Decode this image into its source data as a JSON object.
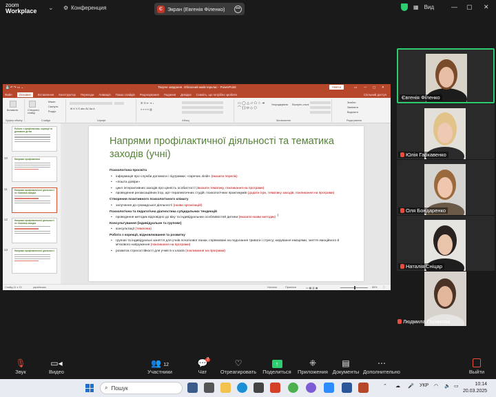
{
  "zoom": {
    "logo_top": "zoom",
    "logo_bottom": "Workplace",
    "conference_label": "Конференция",
    "share_avatar_letter": "Є",
    "share_label": "Экран (Евгенія Філенко)",
    "view_label": "Вид"
  },
  "ppt": {
    "doc_title": "Творче завдання. Обласний майстерклас  -  PowerPoint",
    "signin": "Увійти",
    "tabs": [
      "Файл",
      "Основне",
      "Вставлення",
      "Конструктор",
      "Переходи",
      "Анімація",
      "Показ слайдів",
      "Рецензування",
      "Подання",
      "Довідка",
      "Скажіть, що потрібно зробити"
    ],
    "share_tab": "Спільний доступ",
    "ribbon": {
      "clipboard": "Буфер обміну",
      "slides": "Слайди",
      "font": "Шрифт",
      "paragraph": "Абзац",
      "drawing": "Малювання",
      "editing": "Редагування",
      "insert_btn": "Вставити",
      "new_slide": "Створити слайд",
      "layout": "Макет",
      "reset": "Скинути",
      "section": "Розділ",
      "arrange": "Упорядкувати",
      "quick_styles": "Експрес-стилі",
      "find": "Знайти",
      "replace": "Замінити",
      "select": "Виділити"
    },
    "thumbnails": [
      {
        "num": "",
        "title": "Робота з профілактики, корекції та допомоги дітям"
      },
      {
        "num": "10",
        "title": "Напрями профілактики"
      },
      {
        "num": "11",
        "title": "Напрями профілактичної діяльності та тематика заходів"
      },
      {
        "num": "12",
        "title": "Напрями профілактичної діяльності та тематика заходів"
      },
      {
        "num": "13",
        "title": "Напрями профілактичної діяльності"
      }
    ],
    "slide": {
      "title": "Напрями профілактичної діяльності та тематика заходів (учні)",
      "s1_h": "Психологічна просвіта",
      "s1_b1": "інформація про служби допомоги і підтримки; «гарячих ліній» ",
      "s1_b1_r": "(вказати перелік)",
      "s1_b2": "«пошта довіри»",
      "s1_b3": "цикл інтерактивних заходів про цінність особистості ",
      "s1_b3_r": "(вказати тематику, покликання на програми)",
      "s1_b4": "проведення релаксаційних ігор, арт-терапевтичних студій, психологічних практикумів ",
      "s1_b4_r": "(додати ігри, тематику заходів, покликання на програми)",
      "s2_h": "Створення позитивного психологічного клімату",
      "s2_b1": "залучення до громадської діяльності ",
      "s2_b1_r": "(назви організацій)",
      "s3_h": "Психологічна та педагогічна діагностика суїцидальних тенденцій",
      "s3_b1": "проведення методик відповідно до віку та індивідуальних особливостей дитини ",
      "s3_b1_r": "(вказати назви методик)",
      "s4_h": "Консультування (індивідуальне та групове)",
      "s4_b1": "консультації ",
      "s4_b1_r": "(тематика)",
      "s5_h": "Робота з корекції, відновлювання та розвитку",
      "s5_b1": "групові та індивідуальні заняття для учнів початкової ланки, спрямовані на подолання тривоги і стресу; керування емоціями, зняття емоційного й м'язового напруження ",
      "s5_b1_r": "(покликання на програми)",
      "s5_b2": "розвиток стресостійкості для учнів 5-х класів ",
      "s5_b2_r": "(покликання на програми)"
    },
    "status": {
      "slide_counter": "Слайд 11 з 13",
      "language": "українська",
      "notes": "Нотатки",
      "comments": "Примітки",
      "zoom": "85%"
    }
  },
  "participants": [
    {
      "name": "Євгенія Філенко",
      "muted": false
    },
    {
      "name": "Юлія Гаркавенко",
      "muted": true
    },
    {
      "name": "Оля Бондаренко",
      "muted": true
    },
    {
      "name": "Наталія Сніцар",
      "muted": true
    },
    {
      "name": "Людмила Полякова",
      "muted": true
    }
  ],
  "toolbar": {
    "audio": "Звук",
    "video": "Видео",
    "participants": "Участники",
    "participants_count": "12",
    "chat": "Чат",
    "chat_badge": "7",
    "react": "Отреагировать",
    "share": "Поделиться",
    "apps": "Приложения",
    "docs": "Документы",
    "more": "Дополнительно",
    "exit": "Выйти"
  },
  "taskbar": {
    "search_placeholder": "Пошук",
    "lang": "УКР",
    "time": "10:14",
    "date": "20.03.2025"
  },
  "colors": {
    "ppt_red": "#b7472a",
    "slide_green": "#548235",
    "red_text": "#c00000",
    "zoom_green": "#2ecc71"
  }
}
